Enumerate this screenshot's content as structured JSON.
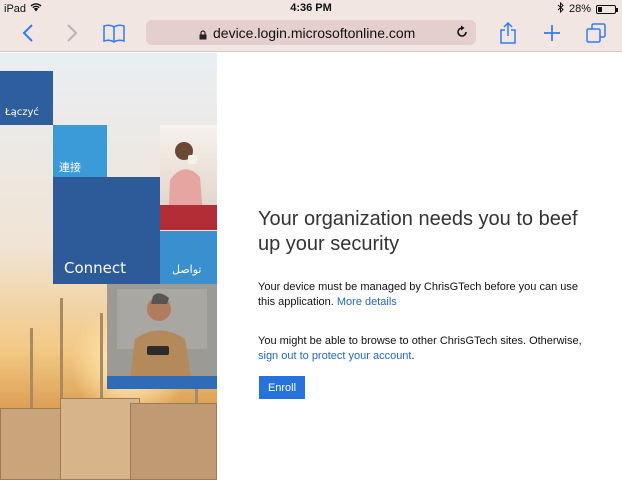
{
  "status_bar": {
    "device": "iPad",
    "time": "4:36 PM",
    "battery": "28%",
    "battery_level": 0.28
  },
  "toolbar": {
    "url": "device.login.microsoftonline.com"
  },
  "hero": {
    "tiles": {
      "polish": "Łączyć",
      "chinese": "連接",
      "connect": "Connect",
      "arabic": "تواصل"
    }
  },
  "main": {
    "heading": "Your organization needs you to beef up your security",
    "device_msg": "Your device must be managed by ChrisGTech before you can use this application.",
    "more_details": "More details",
    "browse_msg": "You might be able to browse to other ChrisGTech sites. Otherwise,",
    "sign_out_link": "sign out to protect your account",
    "sign_out_suffix": ".",
    "enroll_button": "Enroll"
  },
  "colors": {
    "link": "#2266c8",
    "button": "#2672de",
    "tile_dark": "#2e5b9a",
    "tile_light": "#3a9ad9",
    "browser_chrome": "#f2e6e3"
  }
}
